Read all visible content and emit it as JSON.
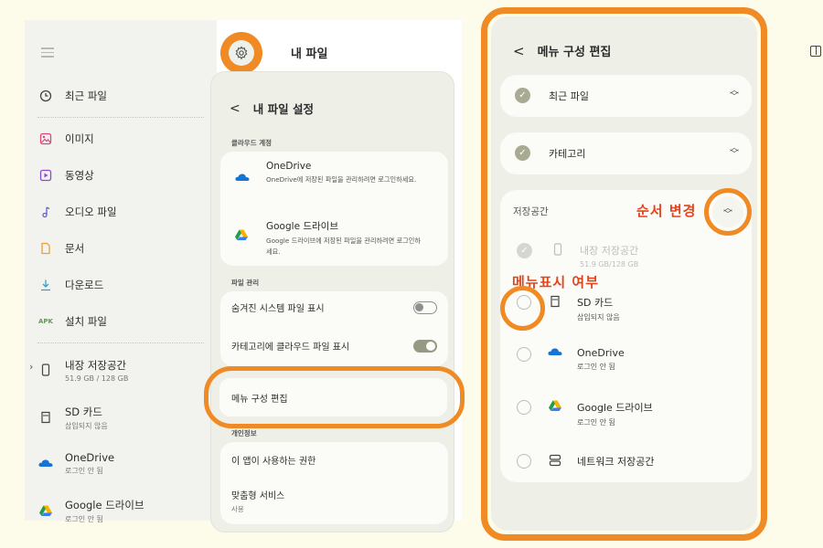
{
  "app": {
    "title": "내 파일"
  },
  "sidebar": {
    "items": [
      {
        "label": "최근 파일",
        "icon": "clock-icon"
      },
      {
        "label": "이미지",
        "icon": "image-icon"
      },
      {
        "label": "동영상",
        "icon": "video-icon"
      },
      {
        "label": "오디오 파일",
        "icon": "music-icon"
      },
      {
        "label": "문서",
        "icon": "document-icon"
      },
      {
        "label": "다운로드",
        "icon": "download-icon"
      },
      {
        "label": "설치 파일",
        "icon": "apk-icon",
        "icon_text": "APK"
      },
      {
        "label": "내장 저장공간",
        "sub": "51.9 GB / 128 GB",
        "icon": "phone-storage-icon"
      },
      {
        "label": "SD 카드",
        "sub": "삽입되지 않음",
        "icon": "sd-card-icon"
      },
      {
        "label": "OneDrive",
        "sub": "로그인 안 됨",
        "icon": "onedrive-icon"
      },
      {
        "label": "Google 드라이브",
        "sub": "로그인 안 됨",
        "icon": "google-drive-icon"
      }
    ]
  },
  "settings": {
    "title": "내 파일 설정",
    "cloud_section": "클라우드 계정",
    "onedrive": {
      "title": "OneDrive",
      "desc": "OneDrive에 저장된 파일을 관리하려면 로그인하세요."
    },
    "gdrive": {
      "title": "Google 드라이브",
      "desc": "Google 드라이브에 저장된 파일을 관리하려면 로그인하세요."
    },
    "file_section": "파일 관리",
    "hidden_files": {
      "label": "숨겨진 시스템 파일 표시",
      "on": false
    },
    "cloud_in_category": {
      "label": "카테고리에 클라우드 파일 표시",
      "on": true
    },
    "menu_edit": "메뉴 구성 편집",
    "privacy_section": "개인정보",
    "permissions": "이 앱이 사용하는 권한",
    "custom_service": {
      "label": "맞춤형 서비스",
      "sub": "사용"
    }
  },
  "menu_editor": {
    "title": "메뉴 구성 편집",
    "recent": "최근 파일",
    "category": "카테고리",
    "storage_section": "저장공간",
    "storage_items": [
      {
        "label": "내장 저장공간",
        "sub": "51.9 GB/128 GB",
        "icon": "phone-storage-icon",
        "state": "disabled"
      },
      {
        "label": "SD 카드",
        "sub": "삽입되지 않음",
        "icon": "sd-card-icon",
        "state": "unchecked"
      },
      {
        "label": "OneDrive",
        "sub": "로그인 안 됨",
        "icon": "onedrive-icon",
        "state": "unchecked"
      },
      {
        "label": "Google 드라이브",
        "sub": "로그인 안 됨",
        "icon": "google-drive-icon",
        "state": "unchecked"
      },
      {
        "label": "네트워크 저장공간",
        "sub": "",
        "icon": "network-storage-icon",
        "state": "unchecked"
      }
    ]
  },
  "annotations": {
    "order_change": "순서 변경",
    "menu_visibility": "메뉴표시 여부"
  },
  "colors": {
    "highlight": "#f08a24",
    "annotation_text": "#e2451c",
    "panel_bg": "#eef0e8"
  }
}
